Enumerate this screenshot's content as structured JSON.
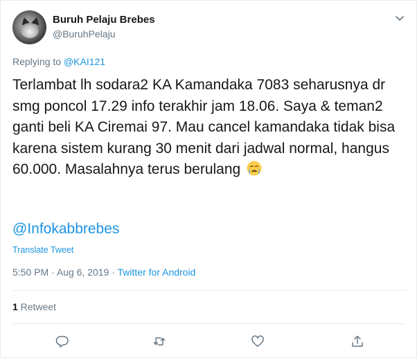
{
  "author": {
    "display_name": "Buruh Pelaju Brebes",
    "handle": "@BuruhPelaju"
  },
  "reply": {
    "prefix": "Replying to ",
    "mention": "@KAI121"
  },
  "tweet": {
    "text": "Terlambat lh sodara2 KA Kamandaka 7083 seharusnya dr smg poncol 17.29 info terakhir jam 18.06. Saya & teman2 ganti beli KA Ciremai 97. Mau cancel kamandaka tidak bisa karena sistem kurang 30 menit dari jadwal normal, hangus 60.000. Masalahnya terus berulang",
    "emoji": "loudly-crying-face-emoji",
    "mention_link": "@Infokabbrebes",
    "translate_label": "Translate Tweet"
  },
  "meta": {
    "time": "5:50 PM",
    "separator1": " · ",
    "date": "Aug 6, 2019",
    "separator2": " · ",
    "source": "Twitter for Android"
  },
  "stats": {
    "retweet_count": "1",
    "retweet_label": " Retweet"
  },
  "actions": {
    "reply_icon": "reply-icon",
    "retweet_icon": "retweet-icon",
    "like_icon": "heart-icon",
    "share_icon": "share-icon"
  },
  "colors": {
    "link": "#1b95e0",
    "secondary_text": "#657786",
    "primary_text": "#14171a",
    "divider": "#e6ecf0"
  }
}
